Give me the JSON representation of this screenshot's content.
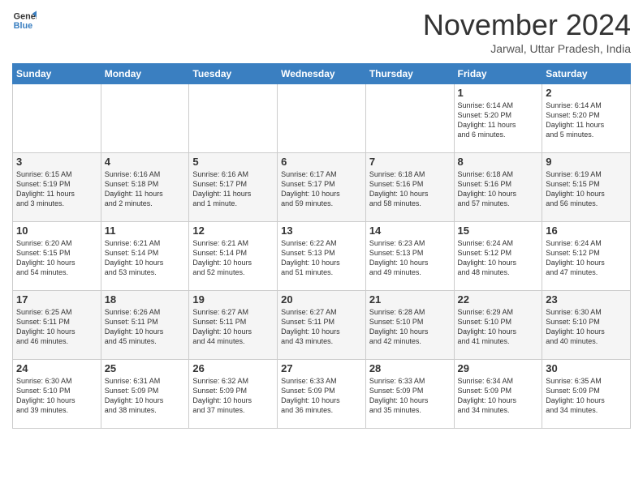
{
  "header": {
    "logo_line1": "General",
    "logo_line2": "Blue",
    "month": "November 2024",
    "location": "Jarwal, Uttar Pradesh, India"
  },
  "weekdays": [
    "Sunday",
    "Monday",
    "Tuesday",
    "Wednesday",
    "Thursday",
    "Friday",
    "Saturday"
  ],
  "weeks": [
    [
      {
        "day": "",
        "info": ""
      },
      {
        "day": "",
        "info": ""
      },
      {
        "day": "",
        "info": ""
      },
      {
        "day": "",
        "info": ""
      },
      {
        "day": "",
        "info": ""
      },
      {
        "day": "1",
        "info": "Sunrise: 6:14 AM\nSunset: 5:20 PM\nDaylight: 11 hours\nand 6 minutes."
      },
      {
        "day": "2",
        "info": "Sunrise: 6:14 AM\nSunset: 5:20 PM\nDaylight: 11 hours\nand 5 minutes."
      }
    ],
    [
      {
        "day": "3",
        "info": "Sunrise: 6:15 AM\nSunset: 5:19 PM\nDaylight: 11 hours\nand 3 minutes."
      },
      {
        "day": "4",
        "info": "Sunrise: 6:16 AM\nSunset: 5:18 PM\nDaylight: 11 hours\nand 2 minutes."
      },
      {
        "day": "5",
        "info": "Sunrise: 6:16 AM\nSunset: 5:17 PM\nDaylight: 11 hours\nand 1 minute."
      },
      {
        "day": "6",
        "info": "Sunrise: 6:17 AM\nSunset: 5:17 PM\nDaylight: 10 hours\nand 59 minutes."
      },
      {
        "day": "7",
        "info": "Sunrise: 6:18 AM\nSunset: 5:16 PM\nDaylight: 10 hours\nand 58 minutes."
      },
      {
        "day": "8",
        "info": "Sunrise: 6:18 AM\nSunset: 5:16 PM\nDaylight: 10 hours\nand 57 minutes."
      },
      {
        "day": "9",
        "info": "Sunrise: 6:19 AM\nSunset: 5:15 PM\nDaylight: 10 hours\nand 56 minutes."
      }
    ],
    [
      {
        "day": "10",
        "info": "Sunrise: 6:20 AM\nSunset: 5:15 PM\nDaylight: 10 hours\nand 54 minutes."
      },
      {
        "day": "11",
        "info": "Sunrise: 6:21 AM\nSunset: 5:14 PM\nDaylight: 10 hours\nand 53 minutes."
      },
      {
        "day": "12",
        "info": "Sunrise: 6:21 AM\nSunset: 5:14 PM\nDaylight: 10 hours\nand 52 minutes."
      },
      {
        "day": "13",
        "info": "Sunrise: 6:22 AM\nSunset: 5:13 PM\nDaylight: 10 hours\nand 51 minutes."
      },
      {
        "day": "14",
        "info": "Sunrise: 6:23 AM\nSunset: 5:13 PM\nDaylight: 10 hours\nand 49 minutes."
      },
      {
        "day": "15",
        "info": "Sunrise: 6:24 AM\nSunset: 5:12 PM\nDaylight: 10 hours\nand 48 minutes."
      },
      {
        "day": "16",
        "info": "Sunrise: 6:24 AM\nSunset: 5:12 PM\nDaylight: 10 hours\nand 47 minutes."
      }
    ],
    [
      {
        "day": "17",
        "info": "Sunrise: 6:25 AM\nSunset: 5:11 PM\nDaylight: 10 hours\nand 46 minutes."
      },
      {
        "day": "18",
        "info": "Sunrise: 6:26 AM\nSunset: 5:11 PM\nDaylight: 10 hours\nand 45 minutes."
      },
      {
        "day": "19",
        "info": "Sunrise: 6:27 AM\nSunset: 5:11 PM\nDaylight: 10 hours\nand 44 minutes."
      },
      {
        "day": "20",
        "info": "Sunrise: 6:27 AM\nSunset: 5:11 PM\nDaylight: 10 hours\nand 43 minutes."
      },
      {
        "day": "21",
        "info": "Sunrise: 6:28 AM\nSunset: 5:10 PM\nDaylight: 10 hours\nand 42 minutes."
      },
      {
        "day": "22",
        "info": "Sunrise: 6:29 AM\nSunset: 5:10 PM\nDaylight: 10 hours\nand 41 minutes."
      },
      {
        "day": "23",
        "info": "Sunrise: 6:30 AM\nSunset: 5:10 PM\nDaylight: 10 hours\nand 40 minutes."
      }
    ],
    [
      {
        "day": "24",
        "info": "Sunrise: 6:30 AM\nSunset: 5:10 PM\nDaylight: 10 hours\nand 39 minutes."
      },
      {
        "day": "25",
        "info": "Sunrise: 6:31 AM\nSunset: 5:09 PM\nDaylight: 10 hours\nand 38 minutes."
      },
      {
        "day": "26",
        "info": "Sunrise: 6:32 AM\nSunset: 5:09 PM\nDaylight: 10 hours\nand 37 minutes."
      },
      {
        "day": "27",
        "info": "Sunrise: 6:33 AM\nSunset: 5:09 PM\nDaylight: 10 hours\nand 36 minutes."
      },
      {
        "day": "28",
        "info": "Sunrise: 6:33 AM\nSunset: 5:09 PM\nDaylight: 10 hours\nand 35 minutes."
      },
      {
        "day": "29",
        "info": "Sunrise: 6:34 AM\nSunset: 5:09 PM\nDaylight: 10 hours\nand 34 minutes."
      },
      {
        "day": "30",
        "info": "Sunrise: 6:35 AM\nSunset: 5:09 PM\nDaylight: 10 hours\nand 34 minutes."
      }
    ]
  ]
}
